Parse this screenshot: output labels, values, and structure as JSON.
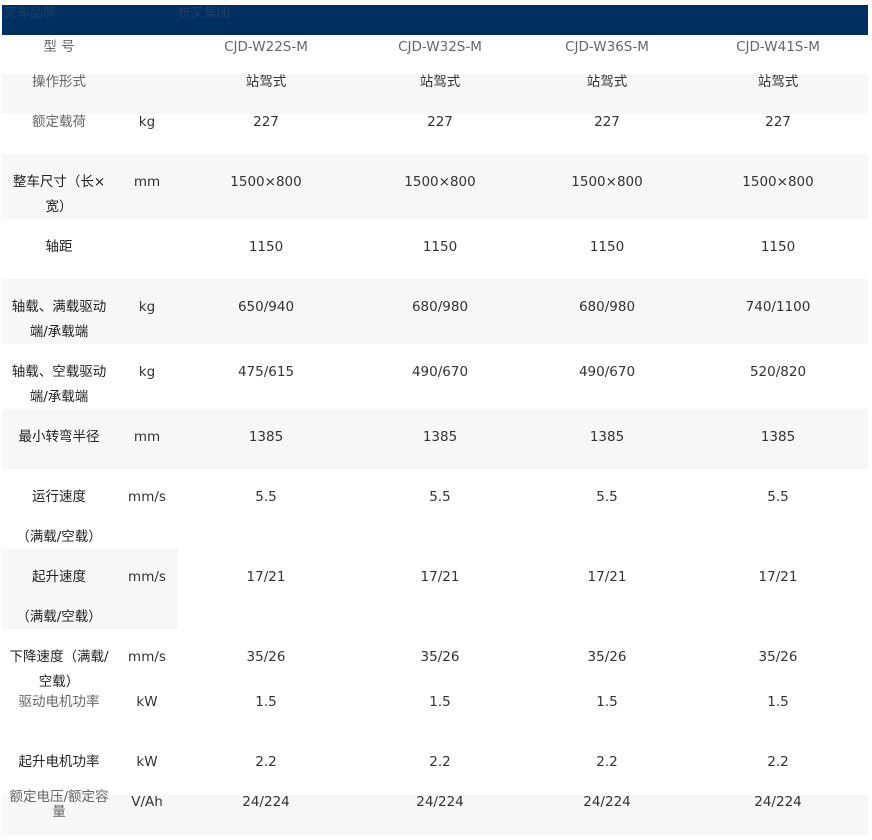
{
  "header": {
    "col1": "叉车品牌",
    "col2": "杭叉集团"
  },
  "models": [
    "CJD-W22S-M",
    "CJD-W32S-M",
    "CJD-W36S-M",
    "CJD-W41S-M"
  ],
  "model_label": "型 号",
  "rows": [
    {
      "label": "操作形式",
      "unit": "",
      "values": [
        "站驾式",
        "站驾式",
        "站驾式",
        "站驾式"
      ]
    },
    {
      "label": "额定载荷",
      "unit": "kg",
      "values": [
        "227",
        "227",
        "227",
        "227"
      ]
    },
    {
      "label": "整车尺寸（长×宽）",
      "unit": "mm",
      "values": [
        "1500×800",
        "1500×800",
        "1500×800",
        "1500×800"
      ]
    },
    {
      "label": "轴距",
      "unit": "",
      "values": [
        "1150",
        "1150",
        "1150",
        "1150"
      ]
    },
    {
      "label": "轴载、满载驱动端/承载端",
      "unit": "kg",
      "values": [
        "650/940",
        "680/980",
        "680/980",
        "740/1100"
      ]
    },
    {
      "label": "轴载、空载驱动端/承载端",
      "unit": "kg",
      "values": [
        "475/615",
        "490/670",
        "490/670",
        "520/820"
      ]
    },
    {
      "label": "最小转弯半径",
      "unit": "mm",
      "values": [
        "1385",
        "1385",
        "1385",
        "1385"
      ]
    },
    {
      "label": "运行速度",
      "label2": "（满载/空载）",
      "unit": "mm/s",
      "values": [
        "5.5",
        "5.5",
        "5.5",
        "5.5"
      ]
    },
    {
      "label": "起升速度",
      "label2": "（满载/空载）",
      "unit": "mm/s",
      "values": [
        "17/21",
        "17/21",
        "17/21",
        "17/21"
      ]
    },
    {
      "label": "下降速度（满载/空载）",
      "unit": "mm/s",
      "values": [
        "35/26",
        "35/26",
        "35/26",
        "35/26"
      ]
    },
    {
      "label": "驱动电机功率",
      "unit": "kW",
      "values": [
        "1.5",
        "1.5",
        "1.5",
        "1.5"
      ]
    },
    {
      "label": "起升电机功率",
      "unit": "kW",
      "values": [
        "2.2",
        "2.2",
        "2.2",
        "2.2"
      ]
    },
    {
      "label": "额定电压/额定容量",
      "unit": "V/Ah",
      "values": [
        "24/224",
        "24/224",
        "24/224",
        "24/224"
      ]
    }
  ]
}
